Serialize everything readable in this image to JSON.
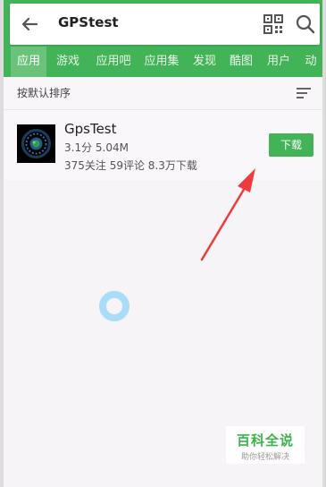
{
  "search": {
    "query": "GPStest"
  },
  "tabs": [
    {
      "label": "应用",
      "active": true
    },
    {
      "label": "游戏"
    },
    {
      "label": "应用吧"
    },
    {
      "label": "应用集"
    },
    {
      "label": "发现"
    },
    {
      "label": "酷图"
    },
    {
      "label": "用户"
    },
    {
      "label": "动"
    }
  ],
  "sort": {
    "label": "按默认排序"
  },
  "app": {
    "name": "GpsTest",
    "meta": "3.1分  5.04M",
    "stats": "375关注  59评论  8.3万下载",
    "download_label": "下载"
  },
  "watermark": {
    "title": "百科全说",
    "subtitle": "助你轻松解决"
  },
  "colors": {
    "brand_green": "#42b357",
    "arrow_red": "#ee3b3b"
  },
  "icons": [
    "back-arrow-icon",
    "qr-code-icon",
    "search-icon",
    "sort-icon",
    "app-icon",
    "loading-icon"
  ]
}
